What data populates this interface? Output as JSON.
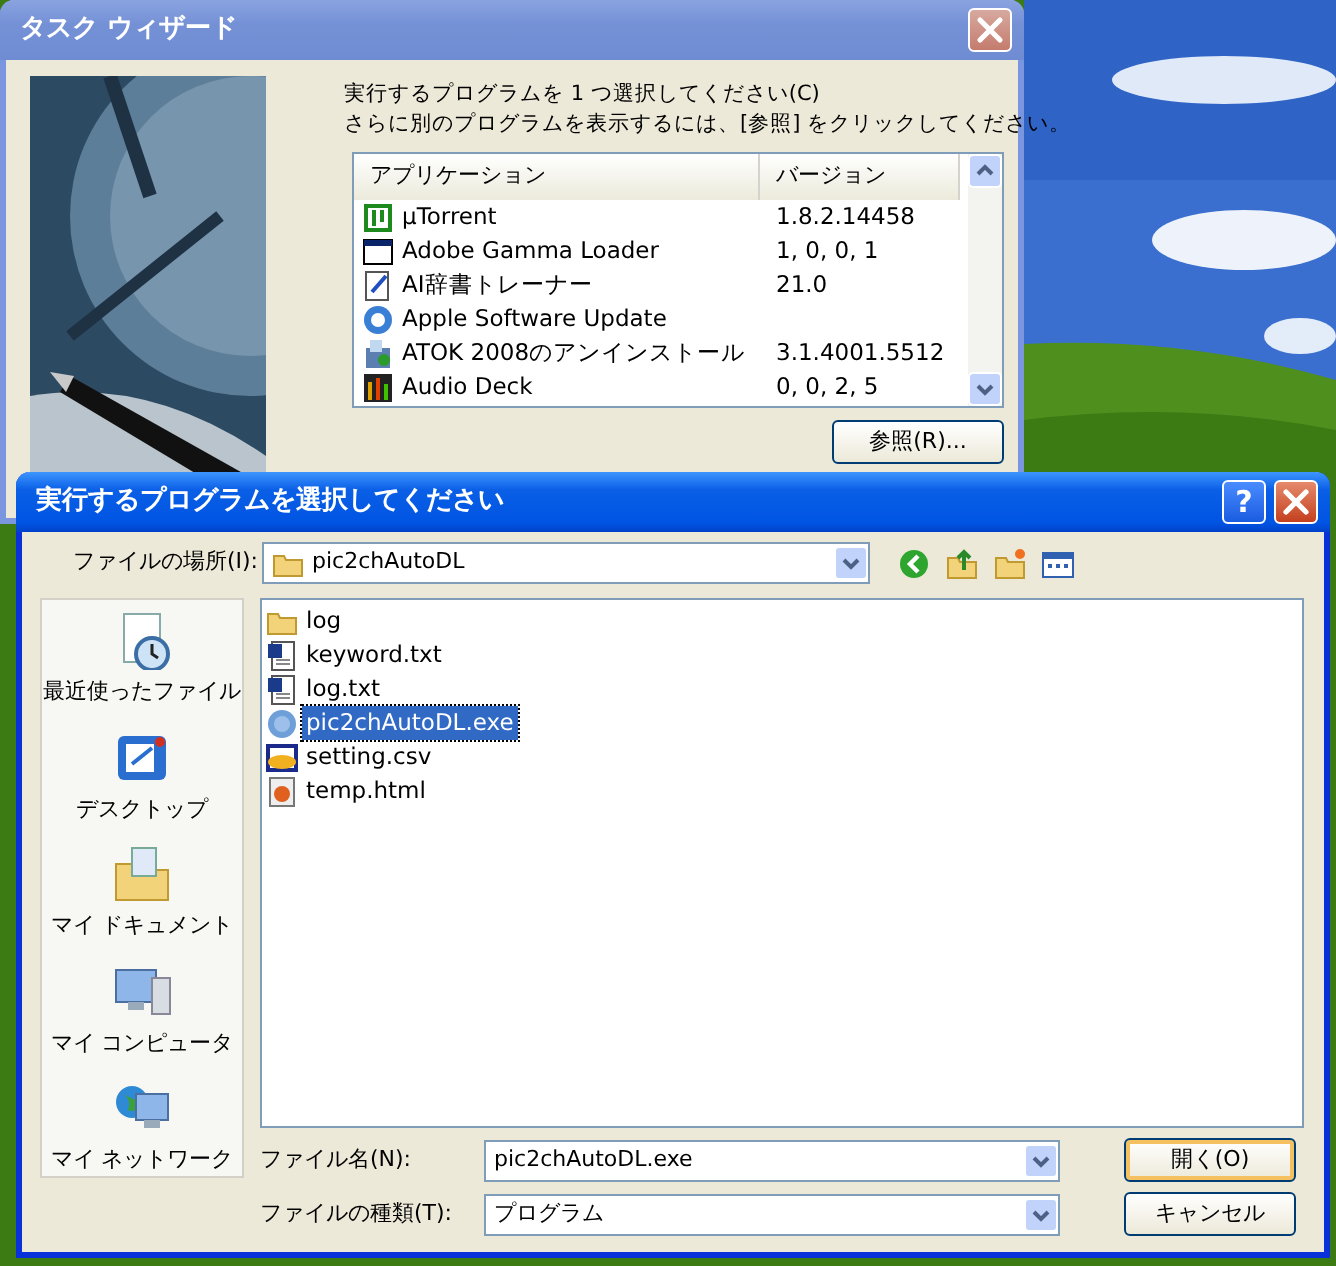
{
  "back_window": {
    "title": "タスク ウィザード",
    "active": false,
    "instructions": [
      "実行するプログラムを 1 つ選択してください(C)",
      "さらに別のプログラムを表示するには、[参照] をクリックしてください。"
    ],
    "columns": [
      "アプリケーション",
      "バージョン"
    ],
    "rows": [
      {
        "name": "µTorrent",
        "version": "1.8.2.14458"
      },
      {
        "name": "Adobe Gamma Loader",
        "version": "1, 0, 0, 1"
      },
      {
        "name": "AI辞書トレーナー",
        "version": "21.0"
      },
      {
        "name": "Apple Software Update",
        "version": ""
      },
      {
        "name": "ATOK 2008のアンインストール",
        "version": "3.1.4001.5512"
      },
      {
        "name": "Audio Deck",
        "version": "0, 0, 2, 5"
      }
    ],
    "browse_button": "参照(R)..."
  },
  "dialog": {
    "title": "実行するプログラムを選択してください",
    "active": true,
    "help_button": "?",
    "location_label": "ファイルの場所(I):",
    "location_value": "pic2chAutoDL",
    "places": [
      "最近使ったファイル",
      "デスクトップ",
      "マイ ドキュメント",
      "マイ コンピュータ",
      "マイ ネットワーク"
    ],
    "files": [
      {
        "name": "log",
        "kind": "folder",
        "selected": false
      },
      {
        "name": "keyword.txt",
        "kind": "text",
        "selected": false
      },
      {
        "name": "log.txt",
        "kind": "text",
        "selected": false
      },
      {
        "name": "pic2chAutoDL.exe",
        "kind": "exe",
        "selected": true
      },
      {
        "name": "setting.csv",
        "kind": "csv",
        "selected": false
      },
      {
        "name": "temp.html",
        "kind": "html",
        "selected": false
      }
    ],
    "filename_label": "ファイル名(N):",
    "filename_value": "pic2chAutoDL.exe",
    "filetype_label": "ファイルの種類(T):",
    "filetype_value": "プログラム",
    "open_button": "開く(O)",
    "cancel_button": "キャンセル"
  }
}
